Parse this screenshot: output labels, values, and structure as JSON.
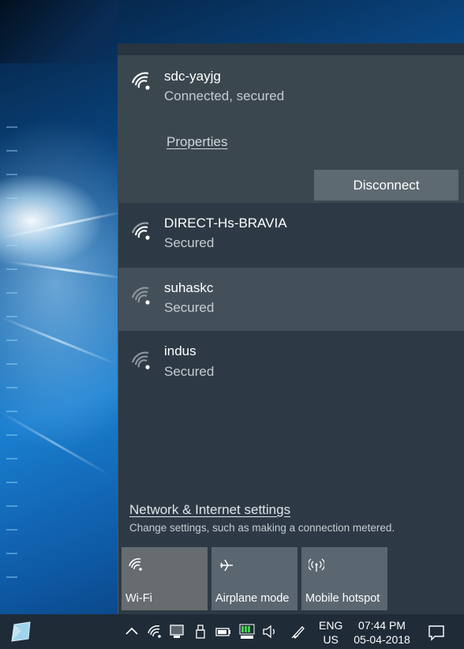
{
  "connected_network": {
    "name": "sdc-yayjg",
    "status": "Connected, secured",
    "properties_label": "Properties",
    "disconnect_label": "Disconnect"
  },
  "networks": [
    {
      "name": "DIRECT-Hs-BRAVIA",
      "status": "Secured"
    },
    {
      "name": "suhaskc",
      "status": "Secured"
    },
    {
      "name": "indus",
      "status": "Secured"
    }
  ],
  "settings": {
    "link_label": "Network & Internet settings",
    "description": "Change settings, such as making a connection metered."
  },
  "quick_actions": [
    {
      "label": "Wi-Fi",
      "icon": "wifi-icon",
      "active": true
    },
    {
      "label": "Airplane mode",
      "icon": "airplane-icon",
      "active": false
    },
    {
      "label": "Mobile hotspot",
      "icon": "hotspot-icon",
      "active": false
    }
  ],
  "taskbar": {
    "language_line1": "ENG",
    "language_line2": "US",
    "time": "07:44 PM",
    "date": "05-04-2018",
    "tray_icons": [
      "chevron-up-icon",
      "wifi-icon",
      "display-icon",
      "usb-icon",
      "battery-icon",
      "meter-icon",
      "volume-icon",
      "pen-icon"
    ]
  },
  "colors": {
    "flyout_bg": "#2d3a45",
    "connected_bg": "#3b474f",
    "hover_bg": "#43505a",
    "taskbar_bg": "#1f2c38"
  }
}
